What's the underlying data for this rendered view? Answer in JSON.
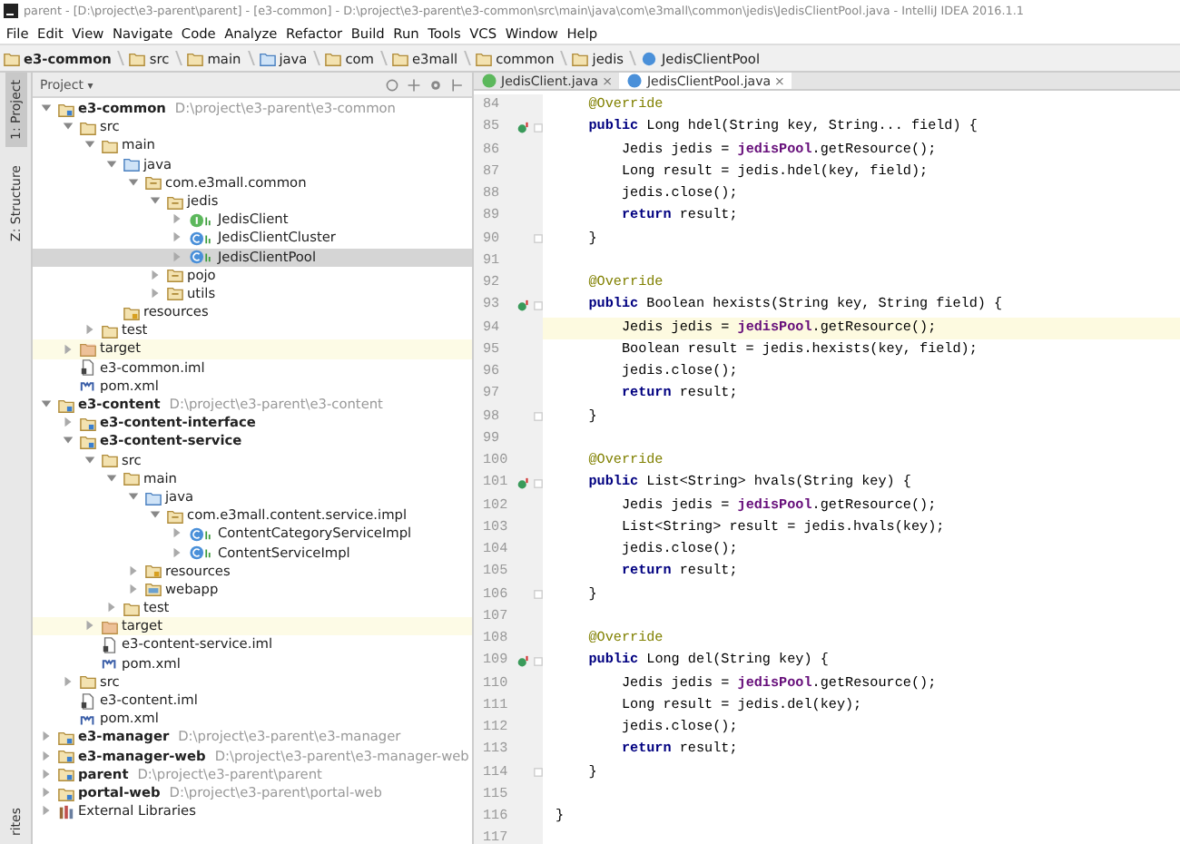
{
  "window": {
    "title": "parent - [D:\\project\\e3-parent\\parent] - [e3-common] - D:\\project\\e3-parent\\e3-common\\src\\main\\java\\com\\e3mall\\common\\jedis\\JedisClientPool.java - IntelliJ IDEA 2016.1.1"
  },
  "menu": [
    "File",
    "Edit",
    "View",
    "Navigate",
    "Code",
    "Analyze",
    "Refactor",
    "Build",
    "Run",
    "Tools",
    "VCS",
    "Window",
    "Help"
  ],
  "breadcrumb": [
    {
      "label": "e3-common",
      "kind": "module"
    },
    {
      "label": "src",
      "kind": "folder"
    },
    {
      "label": "main",
      "kind": "folder"
    },
    {
      "label": "java",
      "kind": "source"
    },
    {
      "label": "com",
      "kind": "package"
    },
    {
      "label": "e3mall",
      "kind": "package"
    },
    {
      "label": "common",
      "kind": "package"
    },
    {
      "label": "jedis",
      "kind": "package"
    },
    {
      "label": "JedisClientPool",
      "kind": "class"
    }
  ],
  "side_tabs_top": [
    {
      "label": "1: Project",
      "selected": true
    },
    {
      "label": "Z: Structure",
      "selected": false
    }
  ],
  "side_tabs_bottom": [
    {
      "label": "rites",
      "selected": false
    }
  ],
  "project_panel": {
    "view": "Project",
    "caret": "▾"
  },
  "tree": [
    {
      "label": "e3-common",
      "kind": "module",
      "bold": true,
      "path": "D:\\project\\e3-parent\\e3-common",
      "expanded": true,
      "selected": false,
      "excluded": false,
      "children": [
        {
          "label": "src",
          "kind": "folder",
          "expanded": true,
          "selected": false,
          "excluded": false,
          "children": [
            {
              "label": "main",
              "kind": "folder",
              "expanded": true,
              "selected": false,
              "excluded": false,
              "children": [
                {
                  "label": "java",
                  "kind": "source",
                  "expanded": true,
                  "selected": false,
                  "excluded": false,
                  "children": [
                    {
                      "label": "com.e3mall.common",
                      "kind": "package",
                      "expanded": true,
                      "selected": false,
                      "excluded": false,
                      "children": [
                        {
                          "label": "jedis",
                          "kind": "package",
                          "expanded": true,
                          "selected": false,
                          "excluded": false,
                          "children": [
                            {
                              "label": "JedisClient",
                              "kind": "interface",
                              "expanded": false,
                              "selected": false,
                              "excluded": false
                            },
                            {
                              "label": "JedisClientCluster",
                              "kind": "class",
                              "expanded": false,
                              "selected": false,
                              "excluded": false
                            },
                            {
                              "label": "JedisClientPool",
                              "kind": "class",
                              "expanded": false,
                              "selected": true,
                              "excluded": false
                            }
                          ]
                        },
                        {
                          "label": "pojo",
                          "kind": "package",
                          "expanded": false,
                          "selected": false,
                          "excluded": false
                        },
                        {
                          "label": "utils",
                          "kind": "package",
                          "expanded": false,
                          "selected": false,
                          "excluded": false
                        }
                      ]
                    }
                  ]
                },
                {
                  "label": "resources",
                  "kind": "resources",
                  "selected": false,
                  "excluded": false
                }
              ]
            },
            {
              "label": "test",
              "kind": "folder",
              "expanded": false,
              "selected": false,
              "excluded": false
            }
          ]
        },
        {
          "label": "target",
          "kind": "target",
          "expanded": false,
          "selected": false,
          "excluded": true
        },
        {
          "label": "e3-common.iml",
          "kind": "iml",
          "selected": false,
          "excluded": false
        },
        {
          "label": "pom.xml",
          "kind": "pom",
          "selected": false,
          "excluded": false
        }
      ]
    },
    {
      "label": "e3-content",
      "kind": "module",
      "bold": true,
      "path": "D:\\project\\e3-parent\\e3-content",
      "expanded": true,
      "selected": false,
      "excluded": false,
      "children": [
        {
          "label": "e3-content-interface",
          "kind": "module",
          "bold": true,
          "expanded": false,
          "selected": false,
          "excluded": false
        },
        {
          "label": "e3-content-service",
          "kind": "module",
          "bold": true,
          "expanded": true,
          "selected": false,
          "excluded": false,
          "children": [
            {
              "label": "src",
              "kind": "folder",
              "expanded": true,
              "selected": false,
              "excluded": false,
              "children": [
                {
                  "label": "main",
                  "kind": "folder",
                  "expanded": true,
                  "selected": false,
                  "excluded": false,
                  "children": [
                    {
                      "label": "java",
                      "kind": "source",
                      "expanded": true,
                      "selected": false,
                      "excluded": false,
                      "children": [
                        {
                          "label": "com.e3mall.content.service.impl",
                          "kind": "package",
                          "expanded": true,
                          "selected": false,
                          "excluded": false,
                          "children": [
                            {
                              "label": "ContentCategoryServiceImpl",
                              "kind": "class",
                              "expanded": false,
                              "selected": false,
                              "excluded": false
                            },
                            {
                              "label": "ContentServiceImpl",
                              "kind": "class",
                              "expanded": false,
                              "selected": false,
                              "excluded": false
                            }
                          ]
                        }
                      ]
                    },
                    {
                      "label": "resources",
                      "kind": "resources",
                      "expanded": false,
                      "selected": false,
                      "excluded": false
                    },
                    {
                      "label": "webapp",
                      "kind": "web",
                      "expanded": false,
                      "selected": false,
                      "excluded": false
                    }
                  ]
                },
                {
                  "label": "test",
                  "kind": "folder",
                  "expanded": false,
                  "selected": false,
                  "excluded": false
                }
              ]
            },
            {
              "label": "target",
              "kind": "target",
              "expanded": false,
              "selected": false,
              "excluded": true
            },
            {
              "label": "e3-content-service.iml",
              "kind": "iml",
              "selected": false,
              "excluded": false
            },
            {
              "label": "pom.xml",
              "kind": "pom",
              "selected": false,
              "excluded": false
            }
          ]
        },
        {
          "label": "src",
          "kind": "folder",
          "expanded": false,
          "selected": false,
          "excluded": false
        },
        {
          "label": "e3-content.iml",
          "kind": "iml",
          "selected": false,
          "excluded": false
        },
        {
          "label": "pom.xml",
          "kind": "pom",
          "selected": false,
          "excluded": false
        }
      ]
    },
    {
      "label": "e3-manager",
      "kind": "module",
      "bold": true,
      "path": "D:\\project\\e3-parent\\e3-manager",
      "expanded": false,
      "selected": false,
      "excluded": false
    },
    {
      "label": "e3-manager-web",
      "kind": "module",
      "bold": true,
      "path": "D:\\project\\e3-parent\\e3-manager-web",
      "expanded": false,
      "selected": false,
      "excluded": false
    },
    {
      "label": "parent",
      "kind": "module",
      "bold": true,
      "path": "D:\\project\\e3-parent\\parent",
      "expanded": false,
      "selected": false,
      "excluded": false
    },
    {
      "label": "portal-web",
      "kind": "module",
      "bold": true,
      "path": "D:\\project\\e3-parent\\portal-web",
      "expanded": false,
      "selected": false,
      "excluded": false
    },
    {
      "label": "External Libraries",
      "kind": "libraries",
      "expanded": false,
      "selected": false,
      "excluded": false
    }
  ],
  "editor_tabs": [
    {
      "label": "JedisClient.java",
      "kind": "interface",
      "close": "×",
      "selected": false
    },
    {
      "label": "JedisClientPool.java",
      "kind": "class",
      "close": "×",
      "selected": true
    }
  ],
  "code": [
    {
      "number": "84",
      "parts": [
        {
          "kind": "ann",
          "text": "    @Override"
        }
      ]
    },
    {
      "number": "85",
      "parts": [
        {
          "kind": "kw",
          "text": "    public"
        },
        {
          "kind": "plain",
          "text": " Long hdel(String key, String... field) {"
        }
      ],
      "gutter_icon": true,
      "fold": true
    },
    {
      "number": "86",
      "parts": [
        {
          "kind": "plain",
          "text": "        Jedis jedis = "
        },
        {
          "kind": "field",
          "text": "jedisPool"
        },
        {
          "kind": "plain",
          "text": ".getResource();"
        }
      ]
    },
    {
      "number": "87",
      "parts": [
        {
          "kind": "plain",
          "text": "        Long result = jedis.hdel(key, field);"
        }
      ]
    },
    {
      "number": "88",
      "parts": [
        {
          "kind": "plain",
          "text": "        jedis.close();"
        }
      ]
    },
    {
      "number": "89",
      "parts": [
        {
          "kind": "kw",
          "text": "        return"
        },
        {
          "kind": "plain",
          "text": " result;"
        }
      ]
    },
    {
      "number": "90",
      "parts": [
        {
          "kind": "plain",
          "text": "    }"
        }
      ],
      "fold": true
    },
    {
      "number": "91"
    },
    {
      "number": "92",
      "parts": [
        {
          "kind": "ann",
          "text": "    @Override"
        }
      ]
    },
    {
      "number": "93",
      "parts": [
        {
          "kind": "kw",
          "text": "    public"
        },
        {
          "kind": "plain",
          "text": " Boolean hexists(String key, String field) {"
        }
      ],
      "gutter_icon": true,
      "fold": true
    },
    {
      "number": "94",
      "parts": [
        {
          "kind": "plain",
          "text": "        Jedis jedis = "
        },
        {
          "kind": "field",
          "text": "jedisPool"
        },
        {
          "kind": "plain",
          "text": ".getResource();"
        }
      ],
      "current": true
    },
    {
      "number": "95",
      "parts": [
        {
          "kind": "plain",
          "text": "        Boolean result = jedis.hexists(key, field);"
        }
      ]
    },
    {
      "number": "96",
      "parts": [
        {
          "kind": "plain",
          "text": "        jedis.close();"
        }
      ]
    },
    {
      "number": "97",
      "parts": [
        {
          "kind": "kw",
          "text": "        return"
        },
        {
          "kind": "plain",
          "text": " result;"
        }
      ]
    },
    {
      "number": "98",
      "parts": [
        {
          "kind": "plain",
          "text": "    }"
        }
      ],
      "fold": true
    },
    {
      "number": "99"
    },
    {
      "number": "100",
      "parts": [
        {
          "kind": "ann",
          "text": "    @Override"
        }
      ]
    },
    {
      "number": "101",
      "parts": [
        {
          "kind": "kw",
          "text": "    public"
        },
        {
          "kind": "plain",
          "text": " List<String> hvals(String key) {"
        }
      ],
      "gutter_icon": true,
      "fold": true
    },
    {
      "number": "102",
      "parts": [
        {
          "kind": "plain",
          "text": "        Jedis jedis = "
        },
        {
          "kind": "field",
          "text": "jedisPool"
        },
        {
          "kind": "plain",
          "text": ".getResource();"
        }
      ]
    },
    {
      "number": "103",
      "parts": [
        {
          "kind": "plain",
          "text": "        List<String> result = jedis.hvals(key);"
        }
      ]
    },
    {
      "number": "104",
      "parts": [
        {
          "kind": "plain",
          "text": "        jedis.close();"
        }
      ]
    },
    {
      "number": "105",
      "parts": [
        {
          "kind": "kw",
          "text": "        return"
        },
        {
          "kind": "plain",
          "text": " result;"
        }
      ]
    },
    {
      "number": "106",
      "parts": [
        {
          "kind": "plain",
          "text": "    }"
        }
      ],
      "fold": true
    },
    {
      "number": "107"
    },
    {
      "number": "108",
      "parts": [
        {
          "kind": "ann",
          "text": "    @Override"
        }
      ]
    },
    {
      "number": "109",
      "parts": [
        {
          "kind": "kw",
          "text": "    public"
        },
        {
          "kind": "plain",
          "text": " Long del(String key) {"
        }
      ],
      "gutter_icon": true,
      "fold": true
    },
    {
      "number": "110",
      "parts": [
        {
          "kind": "plain",
          "text": "        Jedis jedis = "
        },
        {
          "kind": "field",
          "text": "jedisPool"
        },
        {
          "kind": "plain",
          "text": ".getResource();"
        }
      ]
    },
    {
      "number": "111",
      "parts": [
        {
          "kind": "plain",
          "text": "        Long result = jedis.del(key);"
        }
      ]
    },
    {
      "number": "112",
      "parts": [
        {
          "kind": "plain",
          "text": "        jedis.close();"
        }
      ]
    },
    {
      "number": "113",
      "parts": [
        {
          "kind": "kw",
          "text": "        return"
        },
        {
          "kind": "plain",
          "text": " result;"
        }
      ]
    },
    {
      "number": "114",
      "parts": [
        {
          "kind": "plain",
          "text": "    }"
        }
      ],
      "fold": true
    },
    {
      "number": "115"
    },
    {
      "number": "116",
      "parts": [
        {
          "kind": "plain",
          "text": "}"
        }
      ]
    },
    {
      "number": "117"
    }
  ]
}
